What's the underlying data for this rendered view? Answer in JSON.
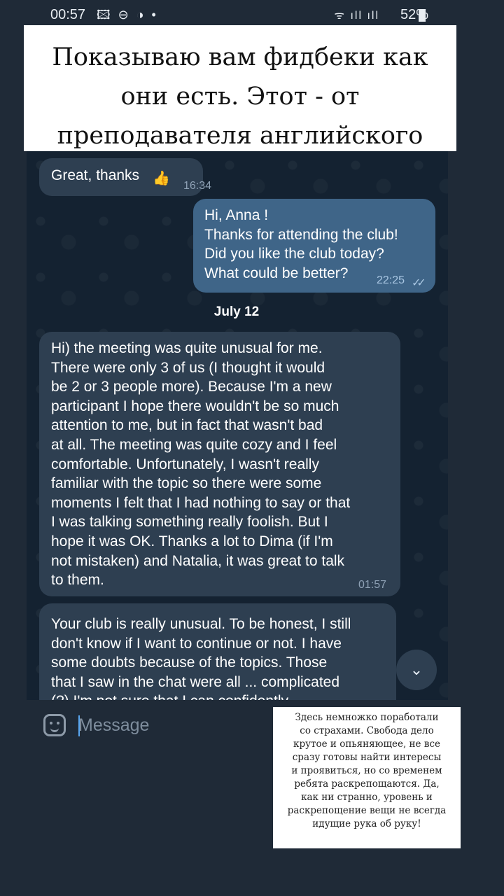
{
  "status_bar": {
    "time": "00:57",
    "left_icons": "🖾 ⊖ ◑ •",
    "signal": "ᯤ ıll ıll",
    "battery": "52%"
  },
  "overlay_title": {
    "lines": [
      "Показываю вам фидбеки как",
      "они есть. Этот - от",
      "преподавателя английского"
    ]
  },
  "chat": {
    "messages": [
      {
        "text": "Great, thanks",
        "reaction": "👍",
        "time": "16:34"
      },
      {
        "text": "Hi, Anna !\nThanks for attending the club!\nDid you like the club today?\nWhat could be better?",
        "time": "22:25",
        "status": "✓✓"
      },
      {
        "text": "Hi) the meeting was quite unusual for me.\nThere were only 3 of us (I thought it would\nbe 2 or 3 people more). Because I'm a new\nparticipant I hope there wouldn't be so much\nattention to me, but in fact that wasn't bad\nat all. The meeting was quite cozy and I feel\ncomfortable. Unfortunately, I wasn't really\nfamiliar with the topic so there were some\nmoments I felt that I had nothing to say or that\nI was talking something really foolish. But I\nhope it was OK. Thanks a lot to Dima (if I'm\nnot mistaken) and Natalia, it was great to talk\nto them.",
        "time": "01:57"
      },
      {
        "text": "Your club is really unusual. To be honest, I still\ndon't know if I want to continue or not. I have\nsome doubts because of the topics. Those\nthat I saw in the chat were all ... complicated\n(?) I'm not sure that I can confidently"
      }
    ],
    "date_separator": "July 12",
    "scroll_icon": "⌄"
  },
  "composer": {
    "placeholder": "Message"
  },
  "overlay_note": {
    "lines": [
      "Здесь немножко поработали",
      "со страхами. Свобода дело",
      "крутое и опьяняющее, не все",
      "сразу готовы найти интересы",
      "и проявиться, но со временем",
      "ребята раскрепощаются. Да,",
      "как ни странно, уровень и",
      "раскрепощение вещи не всегда",
      "идущие рука об руку!"
    ]
  },
  "colors": {
    "background": "#1f2a37",
    "incoming_bubble": "#2e3f51",
    "outgoing_bubble": "#3f6588",
    "accent": "#59a6f0"
  }
}
